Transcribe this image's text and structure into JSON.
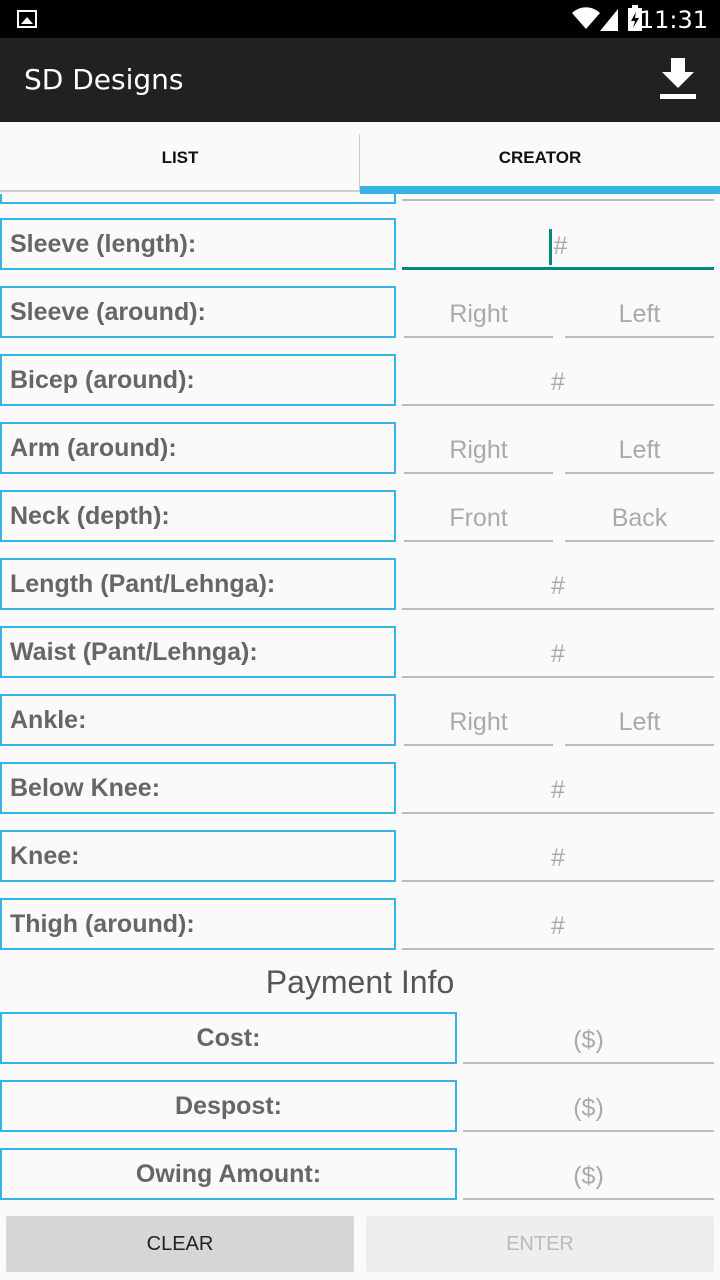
{
  "statusbar": {
    "time": "11:31"
  },
  "appbar": {
    "title": "SD Designs"
  },
  "tabs": [
    {
      "label": "LIST"
    },
    {
      "label": "CREATOR"
    }
  ],
  "measurements": [
    {
      "label": "Sleeve (length):",
      "fields": [
        "#"
      ]
    },
    {
      "label": "Sleeve (around):",
      "fields": [
        "Right",
        "Left"
      ]
    },
    {
      "label": "Bicep (around):",
      "fields": [
        "#"
      ]
    },
    {
      "label": "Arm (around):",
      "fields": [
        "Right",
        "Left"
      ]
    },
    {
      "label": "Neck (depth):",
      "fields": [
        "Front",
        "Back"
      ]
    },
    {
      "label": "Length (Pant/Lehnga):",
      "fields": [
        "#"
      ]
    },
    {
      "label": "Waist (Pant/Lehnga):",
      "fields": [
        "#"
      ]
    },
    {
      "label": "Ankle:",
      "fields": [
        "Right",
        "Left"
      ]
    },
    {
      "label": "Below Knee:",
      "fields": [
        "#"
      ]
    },
    {
      "label": "Knee:",
      "fields": [
        "#"
      ]
    },
    {
      "label": "Thigh (around):",
      "fields": [
        "#"
      ]
    }
  ],
  "payment": {
    "title": "Payment Info",
    "rows": [
      {
        "label": "Cost:",
        "placeholder": "($)"
      },
      {
        "label": "Despost:",
        "placeholder": "($)"
      },
      {
        "label": "Owing Amount:",
        "placeholder": "($)"
      }
    ]
  },
  "buttons": {
    "clear": "CLEAR",
    "enter": "ENTER"
  },
  "colors": {
    "accent": "#33b5e5",
    "focus": "#00897b",
    "appbar": "#212121"
  }
}
